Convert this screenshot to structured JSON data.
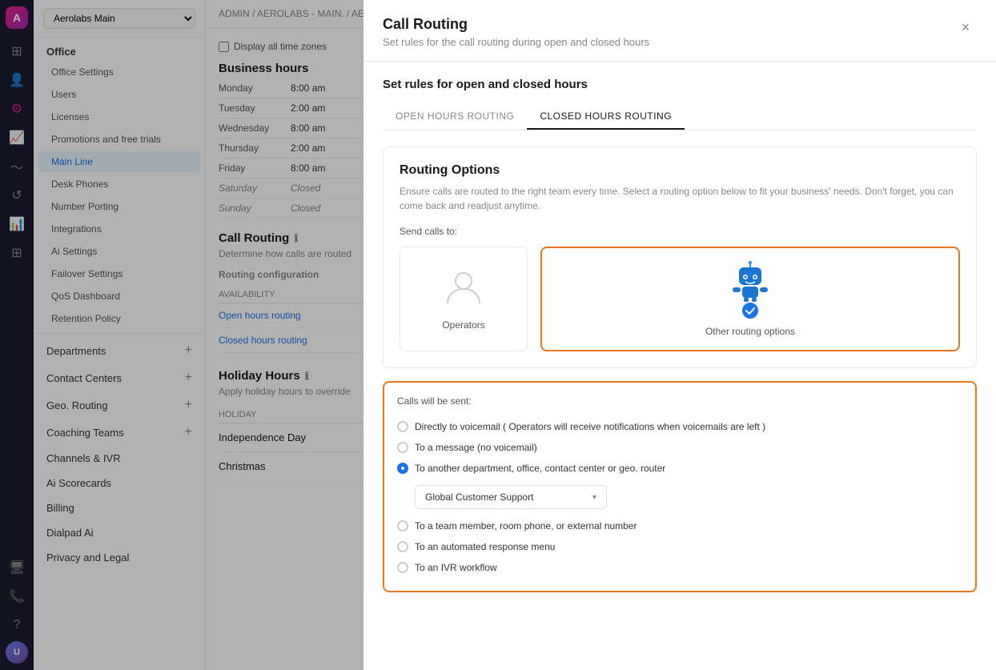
{
  "app": {
    "logo_text": "A",
    "org_name": "Aerolabs Main"
  },
  "breadcrumb": "ADMIN / AEROLABS - MAIN. / AEROLA...",
  "sidebar": {
    "section_office": "Office",
    "items": [
      {
        "id": "office-settings",
        "label": "Office Settings",
        "active": false
      },
      {
        "id": "users",
        "label": "Users",
        "active": false
      },
      {
        "id": "licenses",
        "label": "Licenses",
        "active": false
      },
      {
        "id": "promotions",
        "label": "Promotions and free trials",
        "active": false
      },
      {
        "id": "main-line",
        "label": "Main Line",
        "active": true
      },
      {
        "id": "desk-phones",
        "label": "Desk Phones",
        "active": false
      },
      {
        "id": "number-porting",
        "label": "Number Porting",
        "active": false
      },
      {
        "id": "integrations",
        "label": "Integrations",
        "active": false
      },
      {
        "id": "ai-settings",
        "label": "Ai Settings",
        "active": false
      },
      {
        "id": "failover-settings",
        "label": "Failover Settings",
        "active": false
      },
      {
        "id": "qos-dashboard",
        "label": "QoS Dashboard",
        "active": false
      },
      {
        "id": "retention-policy",
        "label": "Retention Policy",
        "active": false
      }
    ],
    "groups": [
      {
        "id": "departments",
        "label": "Departments"
      },
      {
        "id": "contact-centers",
        "label": "Contact Centers"
      },
      {
        "id": "geo-routing",
        "label": "Geo. Routing"
      },
      {
        "id": "coaching-teams",
        "label": "Coaching Teams"
      },
      {
        "id": "channels-ivr",
        "label": "Channels & IVR"
      },
      {
        "id": "ai-scorecards",
        "label": "Ai Scorecards"
      },
      {
        "id": "billing",
        "label": "Billing"
      },
      {
        "id": "dialpad-ai",
        "label": "Dialpad Ai"
      },
      {
        "id": "privacy-legal",
        "label": "Privacy and Legal"
      }
    ]
  },
  "main": {
    "display_all_timezones_label": "Display all time zones",
    "business_hours_title": "Business hours",
    "hours": [
      {
        "day": "Monday",
        "hours": "8:00 am",
        "closed": false
      },
      {
        "day": "Tuesday",
        "hours": "2:00 am",
        "closed": false
      },
      {
        "day": "Wednesday",
        "hours": "8:00 am",
        "closed": false
      },
      {
        "day": "Thursday",
        "hours": "2:00 am",
        "closed": false
      },
      {
        "day": "Friday",
        "hours": "8:00 am",
        "closed": false
      },
      {
        "day": "Saturday",
        "hours": "Closed",
        "closed": true
      },
      {
        "day": "Sunday",
        "hours": "Closed",
        "closed": true
      }
    ],
    "call_routing_title": "Call Routing",
    "call_routing_subtitle": "Determine how calls are routed",
    "routing_config_title": "Routing configuration",
    "availability_header": "AVAILABILITY",
    "routing_rows": [
      {
        "label": "Open hours routing"
      },
      {
        "label": "Closed hours routing"
      }
    ],
    "holiday_hours_title": "Holiday Hours",
    "holiday_hours_subtitle": "Apply holiday hours to override",
    "holiday_header": "HOLIDAY",
    "holidays": [
      {
        "label": "Independence Day"
      },
      {
        "label": "Christmas"
      }
    ]
  },
  "modal": {
    "title": "Call Routing",
    "subtitle": "Set rules for the call routing during open and closed hours",
    "close_label": "×",
    "section_title": "Set rules for open and closed hours",
    "tabs": [
      {
        "id": "open-hours",
        "label": "OPEN HOURS ROUTING",
        "active": false
      },
      {
        "id": "closed-hours",
        "label": "CLOSED HOURS ROUTING",
        "active": true
      }
    ],
    "routing_options": {
      "title": "Routing Options",
      "description": "Ensure calls are routed to the right team every time. Select a routing option below to fit your business' needs. Don't forget, you can come back and readjust anytime.",
      "send_calls_label": "Send calls to:",
      "choices": [
        {
          "id": "operators",
          "label": "Operators",
          "selected": false
        },
        {
          "id": "other-routing",
          "label": "Other routing options",
          "selected": true
        }
      ]
    },
    "sub_options": {
      "title": "Calls will be sent:",
      "options": [
        {
          "id": "voicemail",
          "label": "Directly to voicemail ( Operators will receive notifications when voicemails are left )",
          "selected": false
        },
        {
          "id": "message",
          "label": "To a message (no voicemail)",
          "selected": false
        },
        {
          "id": "department",
          "label": "To another department, office, contact center or geo. router",
          "selected": true
        },
        {
          "id": "team-member",
          "label": "To a team member, room phone, or external number",
          "selected": false
        },
        {
          "id": "auto-response",
          "label": "To an automated response menu",
          "selected": false
        },
        {
          "id": "ivr",
          "label": "To an IVR workflow",
          "selected": false
        }
      ],
      "dropdown_label": "Global Customer Support",
      "dropdown_chevron": "▾"
    }
  }
}
